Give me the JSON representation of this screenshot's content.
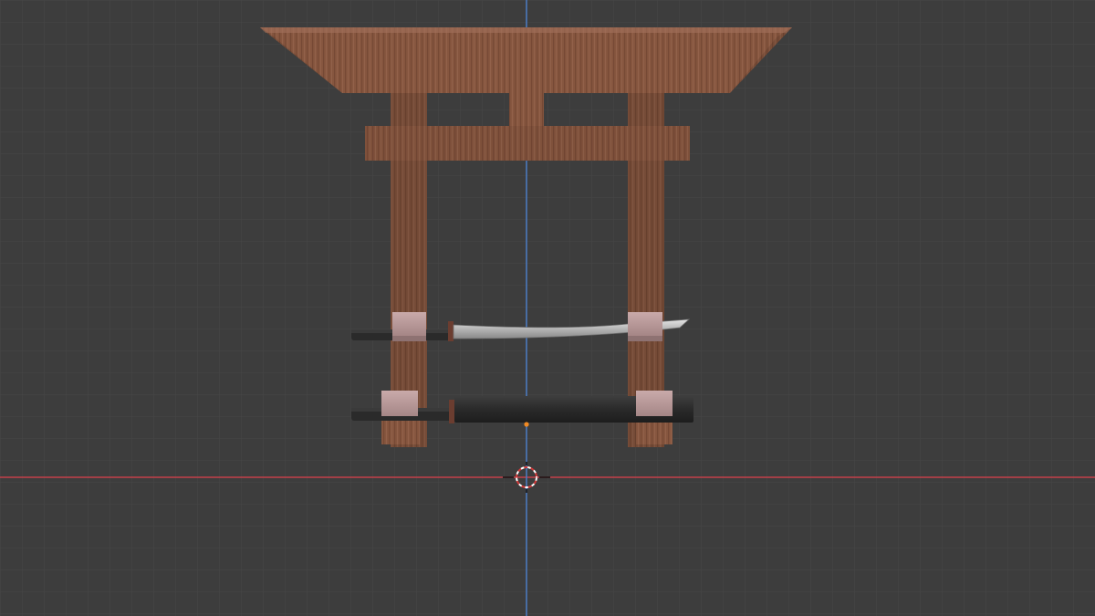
{
  "viewport": {
    "background_color": "#3d3d3d",
    "grid_minor_color": "#474747",
    "grid_major_color": "#4f4f4f",
    "x_axis_color": "#c3404a",
    "y_axis_color": "#4a7bc4"
  },
  "scene": {
    "objects": [
      {
        "name": "torii-gate",
        "material": "wood",
        "color": "#8a5a43"
      },
      {
        "name": "katana-blade",
        "material": "steel",
        "color": "#c8c8c8"
      },
      {
        "name": "katana-scabbard",
        "material": "lacquer",
        "color": "#2e2e2e"
      }
    ],
    "binding_color": "#b89a9a",
    "handle_color": "#2a2a2a"
  },
  "cursor": {
    "icon": "3d-cursor-icon"
  },
  "origin": {
    "icon": "object-origin-icon",
    "color": "#f08a24"
  }
}
